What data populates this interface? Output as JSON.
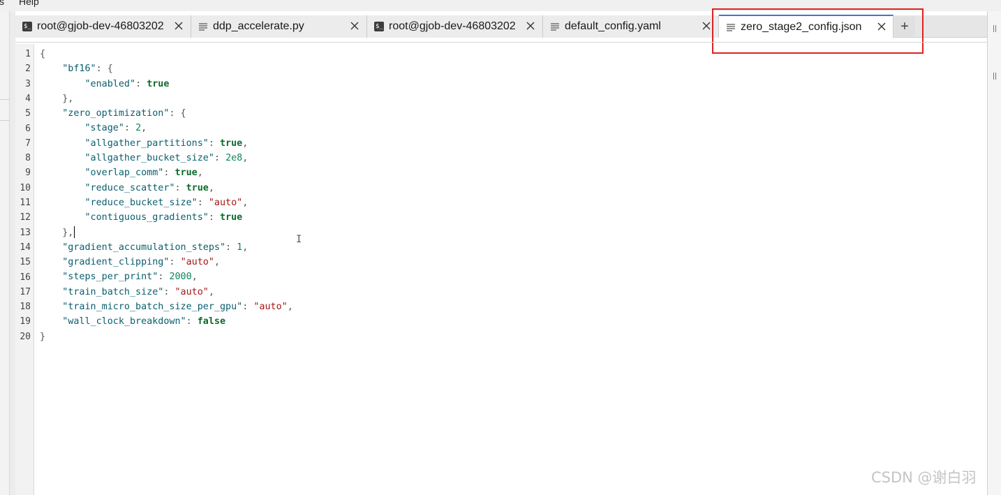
{
  "menubar": {
    "items": [
      "s",
      "Help"
    ]
  },
  "tabs": [
    {
      "label": "root@gjob-dev-46803202",
      "kind": "terminal",
      "active": false
    },
    {
      "label": "ddp_accelerate.py",
      "kind": "file",
      "active": false
    },
    {
      "label": "root@gjob-dev-46803202",
      "kind": "terminal",
      "active": false
    },
    {
      "label": "default_config.yaml",
      "kind": "file",
      "active": false
    },
    {
      "label": "zero_stage2_config.json",
      "kind": "file",
      "active": true
    }
  ],
  "add_tab_label": "+",
  "editor": {
    "line_numbers": [
      "1",
      "2",
      "3",
      "4",
      "5",
      "6",
      "7",
      "8",
      "9",
      "10",
      "11",
      "12",
      "13",
      "14",
      "15",
      "16",
      "17",
      "18",
      "19",
      "20"
    ],
    "lines": [
      [
        {
          "t": "p",
          "v": "{"
        }
      ],
      [
        {
          "t": "p",
          "v": "    "
        },
        {
          "t": "k",
          "v": "\"bf16\""
        },
        {
          "t": "p",
          "v": ": {"
        }
      ],
      [
        {
          "t": "p",
          "v": "        "
        },
        {
          "t": "k",
          "v": "\"enabled\""
        },
        {
          "t": "p",
          "v": ": "
        },
        {
          "t": "b",
          "v": "true"
        }
      ],
      [
        {
          "t": "p",
          "v": "    },"
        }
      ],
      [
        {
          "t": "p",
          "v": "    "
        },
        {
          "t": "k",
          "v": "\"zero_optimization\""
        },
        {
          "t": "p",
          "v": ": {"
        }
      ],
      [
        {
          "t": "p",
          "v": "        "
        },
        {
          "t": "k",
          "v": "\"stage\""
        },
        {
          "t": "p",
          "v": ": "
        },
        {
          "t": "n",
          "v": "2"
        },
        {
          "t": "p",
          "v": ","
        }
      ],
      [
        {
          "t": "p",
          "v": "        "
        },
        {
          "t": "k",
          "v": "\"allgather_partitions\""
        },
        {
          "t": "p",
          "v": ": "
        },
        {
          "t": "b",
          "v": "true"
        },
        {
          "t": "p",
          "v": ","
        }
      ],
      [
        {
          "t": "p",
          "v": "        "
        },
        {
          "t": "k",
          "v": "\"allgather_bucket_size\""
        },
        {
          "t": "p",
          "v": ": "
        },
        {
          "t": "n",
          "v": "2e8"
        },
        {
          "t": "p",
          "v": ","
        }
      ],
      [
        {
          "t": "p",
          "v": "        "
        },
        {
          "t": "k",
          "v": "\"overlap_comm\""
        },
        {
          "t": "p",
          "v": ": "
        },
        {
          "t": "b",
          "v": "true"
        },
        {
          "t": "p",
          "v": ","
        }
      ],
      [
        {
          "t": "p",
          "v": "        "
        },
        {
          "t": "k",
          "v": "\"reduce_scatter\""
        },
        {
          "t": "p",
          "v": ": "
        },
        {
          "t": "b",
          "v": "true"
        },
        {
          "t": "p",
          "v": ","
        }
      ],
      [
        {
          "t": "p",
          "v": "        "
        },
        {
          "t": "k",
          "v": "\"reduce_bucket_size\""
        },
        {
          "t": "p",
          "v": ": "
        },
        {
          "t": "s",
          "v": "\"auto\""
        },
        {
          "t": "p",
          "v": ","
        }
      ],
      [
        {
          "t": "p",
          "v": "        "
        },
        {
          "t": "k",
          "v": "\"contiguous_gradients\""
        },
        {
          "t": "p",
          "v": ": "
        },
        {
          "t": "b",
          "v": "true"
        }
      ],
      [
        {
          "t": "p",
          "v": "    },"
        }
      ],
      [
        {
          "t": "p",
          "v": "    "
        },
        {
          "t": "k",
          "v": "\"gradient_accumulation_steps\""
        },
        {
          "t": "p",
          "v": ": "
        },
        {
          "t": "n",
          "v": "1"
        },
        {
          "t": "p",
          "v": ","
        }
      ],
      [
        {
          "t": "p",
          "v": "    "
        },
        {
          "t": "k",
          "v": "\"gradient_clipping\""
        },
        {
          "t": "p",
          "v": ": "
        },
        {
          "t": "s",
          "v": "\"auto\""
        },
        {
          "t": "p",
          "v": ","
        }
      ],
      [
        {
          "t": "p",
          "v": "    "
        },
        {
          "t": "k",
          "v": "\"steps_per_print\""
        },
        {
          "t": "p",
          "v": ": "
        },
        {
          "t": "n",
          "v": "2000"
        },
        {
          "t": "p",
          "v": ","
        }
      ],
      [
        {
          "t": "p",
          "v": "    "
        },
        {
          "t": "k",
          "v": "\"train_batch_size\""
        },
        {
          "t": "p",
          "v": ": "
        },
        {
          "t": "s",
          "v": "\"auto\""
        },
        {
          "t": "p",
          "v": ","
        }
      ],
      [
        {
          "t": "p",
          "v": "    "
        },
        {
          "t": "k",
          "v": "\"train_micro_batch_size_per_gpu\""
        },
        {
          "t": "p",
          "v": ": "
        },
        {
          "t": "s",
          "v": "\"auto\""
        },
        {
          "t": "p",
          "v": ","
        }
      ],
      [
        {
          "t": "p",
          "v": "    "
        },
        {
          "t": "k",
          "v": "\"wall_clock_breakdown\""
        },
        {
          "t": "p",
          "v": ": "
        },
        {
          "t": "b",
          "v": "false"
        }
      ],
      [
        {
          "t": "p",
          "v": "}"
        }
      ]
    ],
    "caret_line": 13
  },
  "watermark": "CSDN @谢白羽",
  "colors": {
    "highlight_box": "#e02020",
    "active_tab_accent": "#3c79c0"
  }
}
